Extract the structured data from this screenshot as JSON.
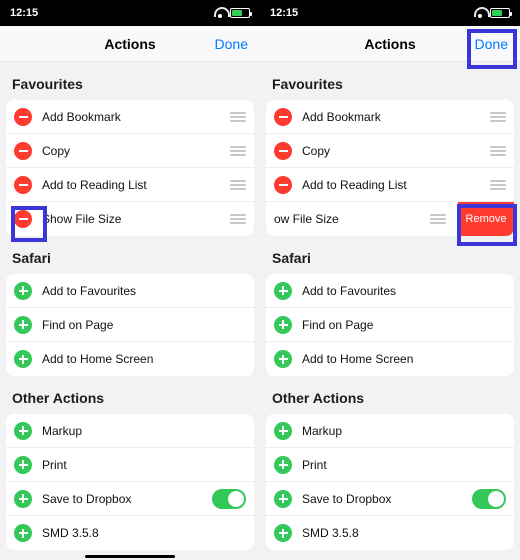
{
  "status": {
    "time": "12:15"
  },
  "nav": {
    "title": "Actions",
    "done": "Done"
  },
  "sections": {
    "favourites": {
      "title": "Favourites",
      "items": [
        {
          "label": "Add Bookmark"
        },
        {
          "label": "Copy"
        },
        {
          "label": "Add to Reading List"
        },
        {
          "label": "Show File Size"
        }
      ]
    },
    "safari": {
      "title": "Safari",
      "items": [
        {
          "label": "Add to Favourites"
        },
        {
          "label": "Find on Page"
        },
        {
          "label": "Add to Home Screen"
        }
      ]
    },
    "other": {
      "title": "Other Actions",
      "items": [
        {
          "label": "Markup"
        },
        {
          "label": "Print"
        },
        {
          "label": "Save to Dropbox"
        },
        {
          "label": "SMD 3.5.8"
        }
      ]
    }
  },
  "right": {
    "slid_label": "ow File Size",
    "remove": "Remove"
  }
}
